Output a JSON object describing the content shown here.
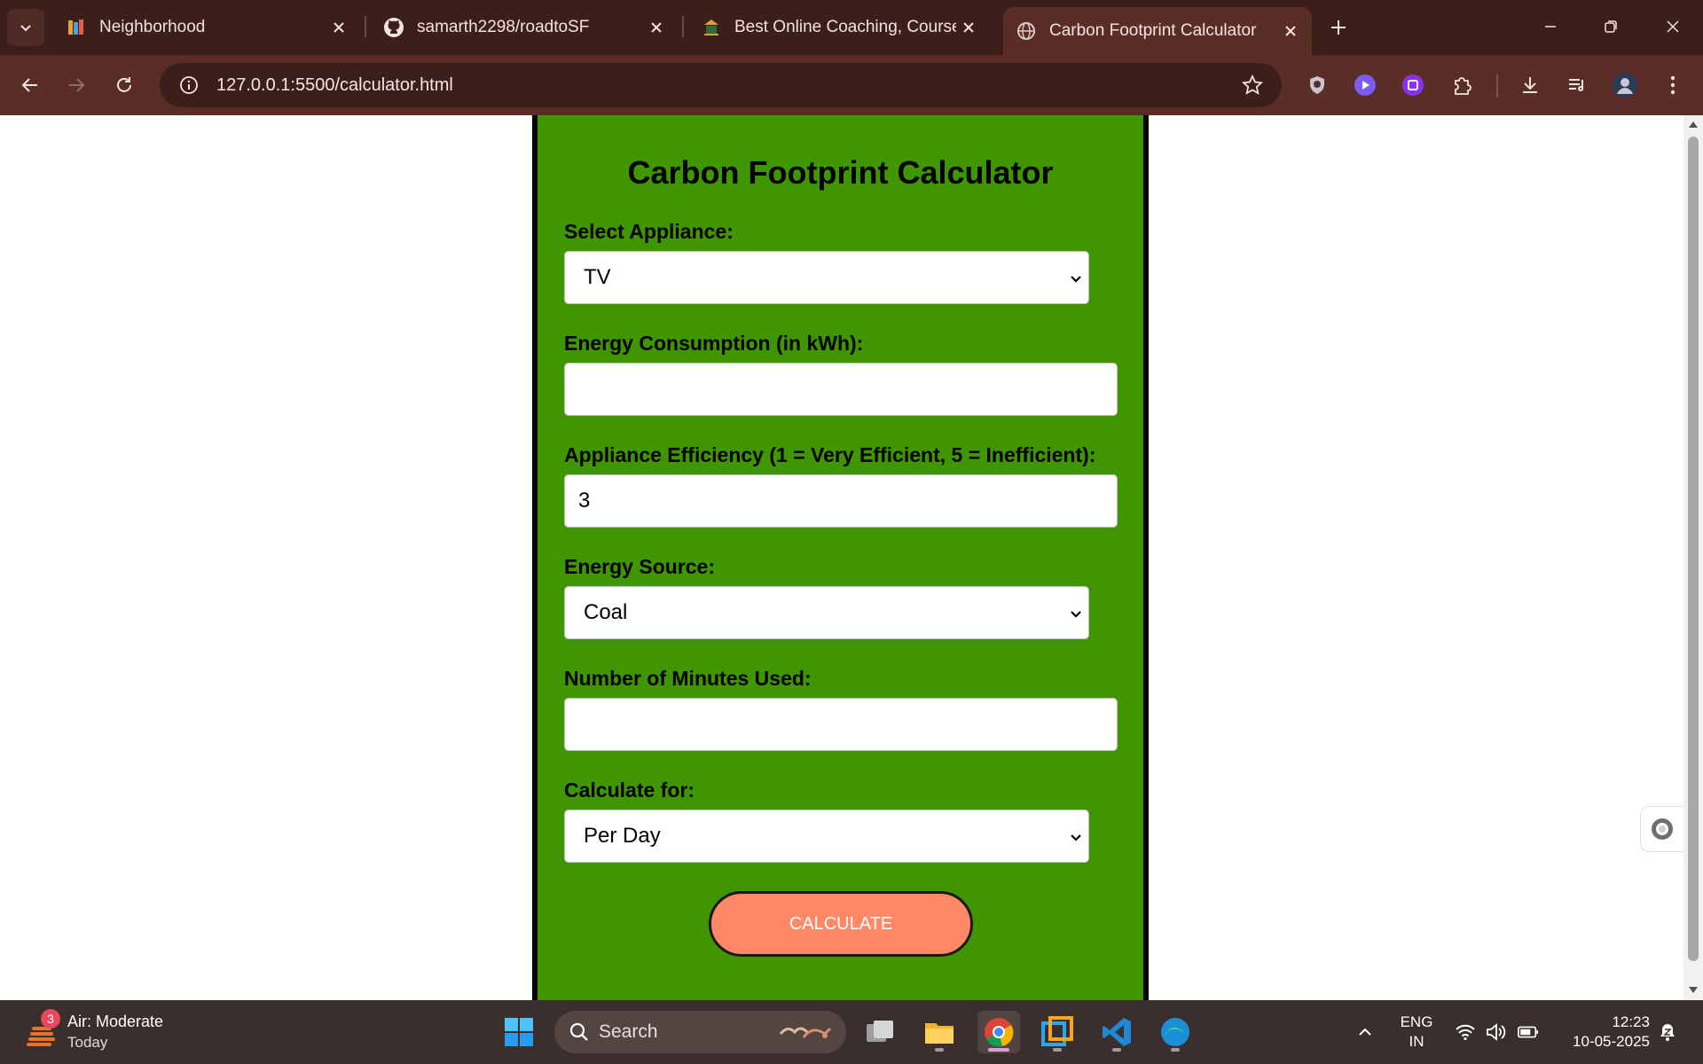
{
  "browser": {
    "tabs": [
      {
        "title": "Neighborhood",
        "icon": "books-icon"
      },
      {
        "title": "samarth2298/roadtoSF",
        "icon": "github-icon"
      },
      {
        "title": "Best Online Coaching, Courses f",
        "icon": "coaching-site-icon"
      },
      {
        "title": "Carbon Footprint Calculator",
        "icon": "globe-icon",
        "active": true
      }
    ],
    "url": "127.0.0.1:5500/calculator.html"
  },
  "calculator": {
    "title": "Carbon Footprint Calculator",
    "appliance_label": "Select Appliance:",
    "appliance_value": "TV",
    "energy_label": "Energy Consumption (in kWh):",
    "energy_value": "",
    "efficiency_label": "Appliance Efficiency (1 = Very Efficient, 5 = Inefficient):",
    "efficiency_value": "3",
    "source_label": "Energy Source:",
    "source_value": "Coal",
    "minutes_label": "Number of Minutes Used:",
    "minutes_value": "",
    "period_label": "Calculate for:",
    "period_value": "Per Day",
    "calculate_button": "CALCULATE"
  },
  "taskbar": {
    "weather_title": "Air: Moderate",
    "weather_sub": "Today",
    "weather_badge": "3",
    "search_label": "Search",
    "lang_top": "ENG",
    "lang_bottom": "IN",
    "time": "12:23",
    "date": "10-05-2025"
  },
  "colors": {
    "card_green": "#3f9600",
    "button_coral": "#ff8966",
    "chrome_dark": "#3c1f1a",
    "chrome_mid": "#5a2e27"
  }
}
